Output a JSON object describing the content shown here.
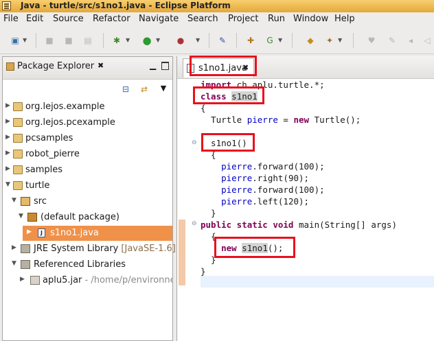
{
  "window": {
    "title": "Java - turtle/src/s1no1.java - Eclipse Platform"
  },
  "menu": [
    "File",
    "Edit",
    "Source",
    "Refactor",
    "Navigate",
    "Search",
    "Project",
    "Run",
    "Window",
    "Help"
  ],
  "package_explorer": {
    "title": "Package Explorer",
    "tree": [
      {
        "label": "org.lejos.example",
        "kind": "project"
      },
      {
        "label": "org.lejos.pcexample",
        "kind": "project"
      },
      {
        "label": "pcsamples",
        "kind": "project"
      },
      {
        "label": "robot_pierre",
        "kind": "project"
      },
      {
        "label": "samples",
        "kind": "project"
      },
      {
        "label": "turtle",
        "kind": "project"
      },
      {
        "label": "src",
        "kind": "source-folder"
      },
      {
        "label": "(default package)",
        "kind": "package"
      },
      {
        "label": "s1no1.java",
        "kind": "java-file",
        "selected": true
      },
      {
        "label": "JRE System Library",
        "decoration": "[JavaSE-1.6]",
        "kind": "library"
      },
      {
        "label": "Referenced Libraries",
        "kind": "library"
      },
      {
        "label": "aplu5.jar",
        "decoration": " - /home/p/environner",
        "kind": "jar"
      }
    ]
  },
  "editor": {
    "tab_label": "s1no1.java",
    "code": {
      "l1_kw": "import",
      "l1_rest": " ch.aplu.turtle.*;",
      "l2_kw": "class",
      "l2_name": "s1no1",
      "l3": "{",
      "l4_type": "  Turtle ",
      "l4_field": "pierre",
      "l4_eq": " = ",
      "l4_kw": "new",
      "l4_rest": " Turtle();",
      "l6": "  s1no1()",
      "l7": "  {",
      "l8_f": "pierre",
      "l8_rest": ".forward(100);",
      "l9_f": "pierre",
      "l9_rest": ".right(90);",
      "l10_f": "pierre",
      "l10_rest": ".forward(100);",
      "l11_f": "pierre",
      "l11_rest": ".left(120);",
      "l12": "  }",
      "l13_kw": "public static void",
      "l13_rest": " main(String[] args)",
      "l14": "  {",
      "l15_kw": "new",
      "l15_sp": " ",
      "l15_name": "s1no1",
      "l15_rest": "();",
      "l16": "  }",
      "l17": "}"
    }
  },
  "colors": {
    "keyword": "#7f0055",
    "field": "#0000c0",
    "selection": "#f0914a",
    "annotation_box": "#e8101c"
  }
}
